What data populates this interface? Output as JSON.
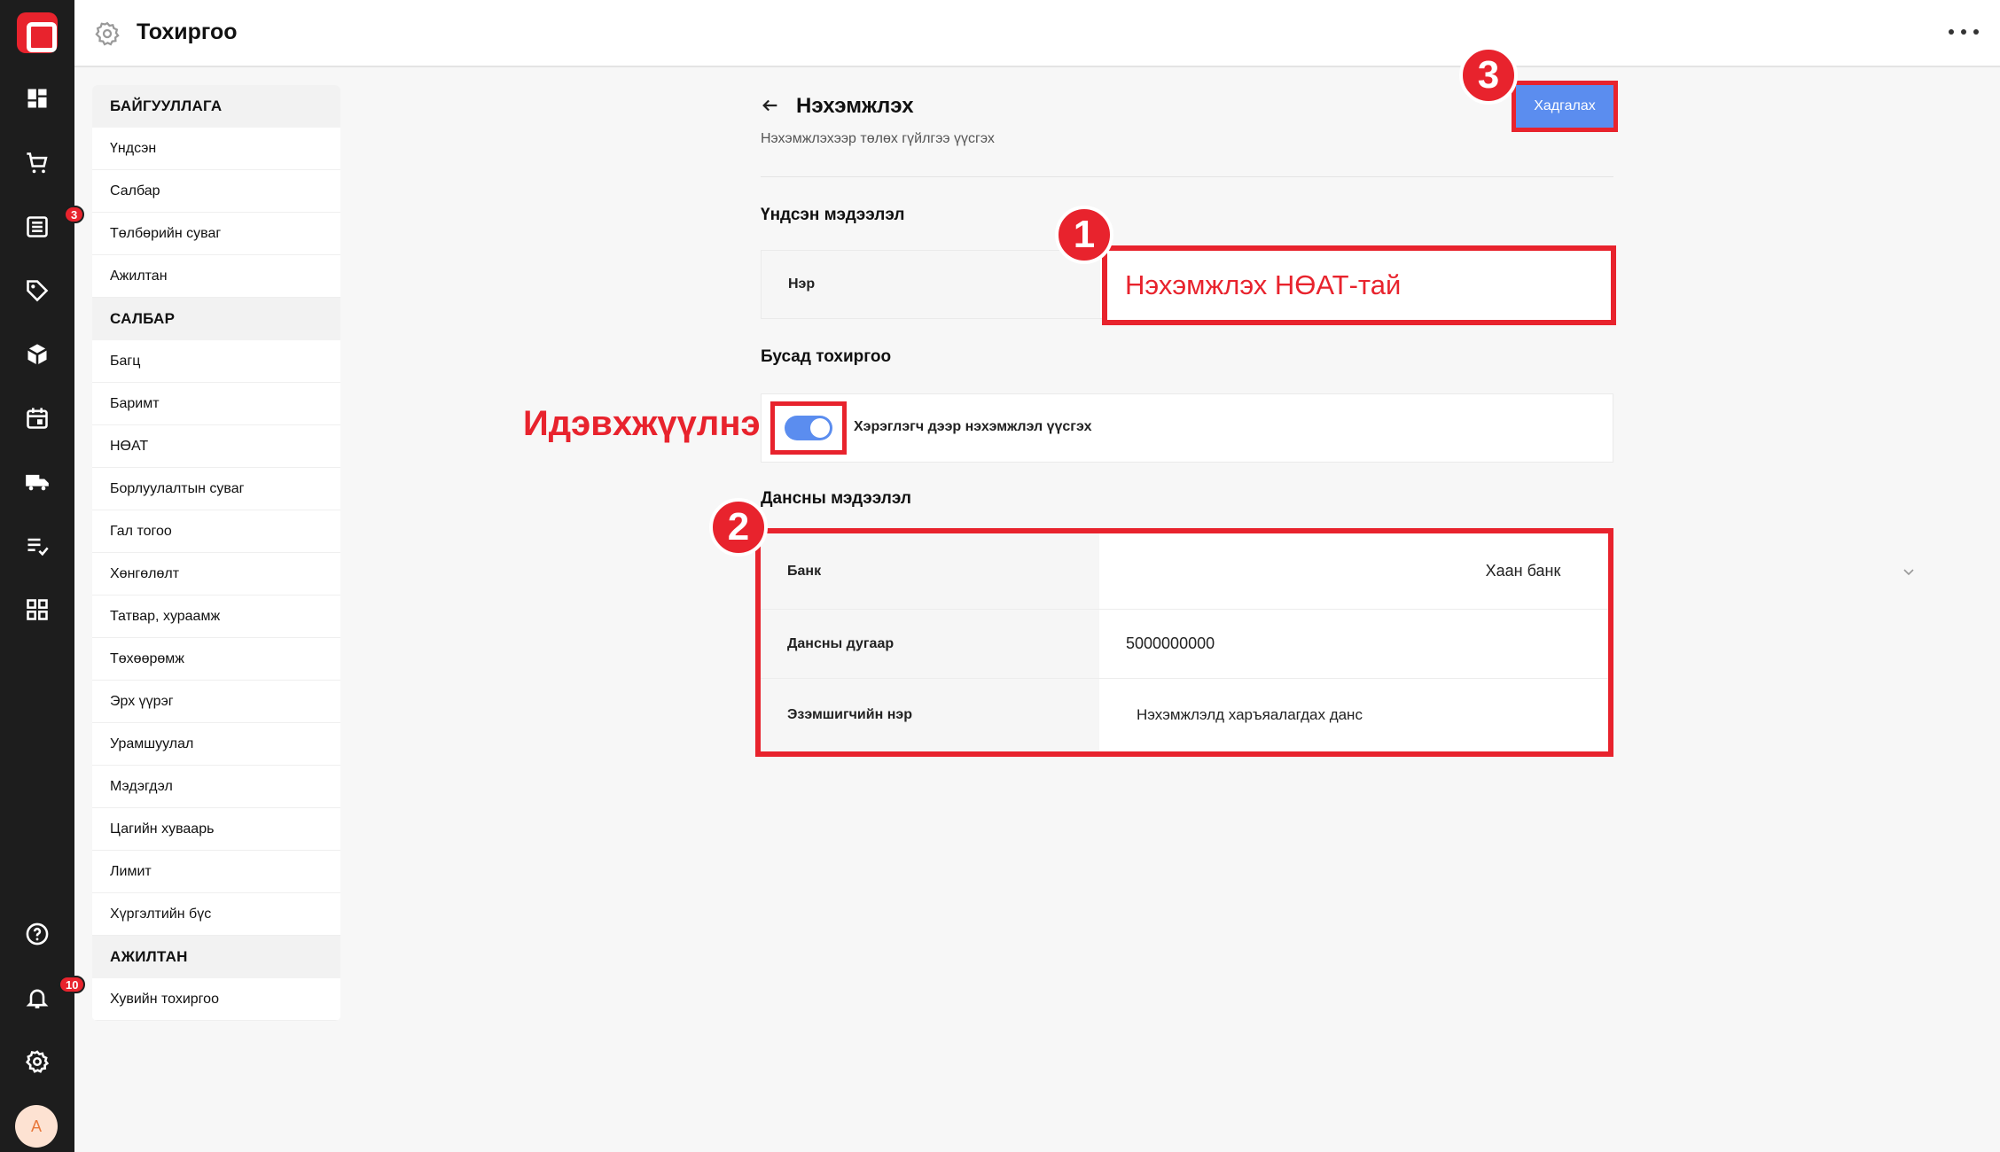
{
  "colors": {
    "accent_red": "#e8232d",
    "primary_blue": "#5b8def",
    "rail_bg": "#1d1d1d",
    "page_bg": "#f7f7f7"
  },
  "rail": {
    "items": [
      {
        "icon": "dashboard-icon"
      },
      {
        "icon": "cart-icon"
      },
      {
        "icon": "list-icon",
        "badge": "3"
      },
      {
        "icon": "tag-icon"
      },
      {
        "icon": "box-icon"
      },
      {
        "icon": "calendar-icon"
      },
      {
        "icon": "truck-icon"
      },
      {
        "icon": "checklist-icon"
      },
      {
        "icon": "apps-grid-icon"
      }
    ],
    "bottom_items": [
      {
        "icon": "help-icon"
      },
      {
        "icon": "bell-icon",
        "badge": "10"
      },
      {
        "icon": "settings-icon"
      }
    ],
    "avatar_letter": "A"
  },
  "header": {
    "title": "Тохиргоо"
  },
  "settings_nav": {
    "groups": [
      {
        "title": "БАЙГУУЛЛАГА",
        "items": [
          "Үндсэн",
          "Салбар",
          "Төлбөрийн суваг",
          "Ажилтан"
        ]
      },
      {
        "title": "САЛБАР",
        "items": [
          "Багц",
          "Баримт",
          "НӨАТ",
          "Борлуулалтын суваг",
          "Гал тогоо",
          "Хөнгөлөлт",
          "Татвар, хураамж",
          "Төхөөрөмж",
          "Эрх үүрэг",
          "Урамшуулал",
          "Мэдэгдэл",
          "Цагийн хуваарь",
          "Лимит",
          "Хүргэлтийн бүс"
        ]
      },
      {
        "title": "АЖИЛТАН",
        "items": [
          "Хувийн тохиргоо"
        ]
      }
    ]
  },
  "main": {
    "title": "Нэхэмжлэх",
    "subtitle": "Нэхэмжлэхээр төлөх гүйлгээ үүсгэх",
    "save_label": "Хадгалах",
    "basic_section": {
      "title": "Үндсэн мэдээлэл",
      "name_label": "Нэр",
      "name_value": "Нэхэмжлэх НӨАТ-тай"
    },
    "other_section": {
      "title": "Бусад тохиргоо",
      "toggle_label": "Хэрэглэгч дээр нэхэмжлэл үүсгэх",
      "toggle_on": true
    },
    "account_section": {
      "title": "Дансны мэдээлэл",
      "bank_label": "Банк",
      "bank_value": "Хаан банк",
      "account_number_label": "Дансны дугаар",
      "account_number_value": "5000000000",
      "owner_label": "Эзэмшигчийн нэр",
      "owner_value": "Нэхэмжлэлд харъяалагдах данс"
    }
  },
  "annotations": {
    "step1": "1",
    "step2": "2",
    "step3": "3",
    "enable_text": "Идэвхжүүлнэ"
  }
}
